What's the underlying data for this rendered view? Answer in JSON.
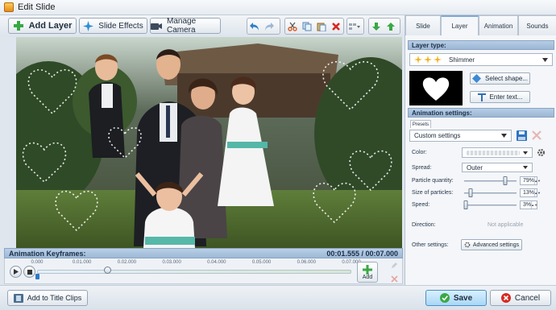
{
  "window": {
    "title": "Edit Slide"
  },
  "toolbar": {
    "add_layer": "Add Layer",
    "slide_effects": "Slide Effects",
    "manage_camera": "Manage Camera"
  },
  "keyframes": {
    "title": "Animation Keyframes:",
    "time": "00:01.555 / 00:07.000",
    "ticks": [
      "0.000",
      "0.01.000",
      "0.02.000",
      "0.03.000",
      "0.04.000",
      "0.05.000",
      "0.06.000",
      "0.07.000"
    ],
    "position": 0.222,
    "add_label": "Add"
  },
  "bottom": {
    "add_to_title_clips": "Add to Title Clips",
    "save": "Save",
    "cancel": "Cancel"
  },
  "panel": {
    "tabs": [
      "Slide",
      "Layer",
      "Animation",
      "Sounds"
    ],
    "active_tab": "Layer",
    "layer_type_header": "Layer type:",
    "layer_type_value": "Shimmer",
    "select_shape": "Select shape...",
    "enter_text": "Enter text...",
    "anim_header": "Animation settings:",
    "presets_label": "Presets",
    "preset_value": "Custom settings",
    "color_label": "Color:",
    "spread_label": "Spread:",
    "spread_value": "Outer",
    "particle_quantity": {
      "label": "Particle quantity:",
      "value": "79%",
      "level": 79
    },
    "particle_size": {
      "label": "Size of particles:",
      "value": "13%",
      "level": 13
    },
    "speed": {
      "label": "Speed:",
      "value": "3%",
      "level": 3
    },
    "direction_label": "Direction:",
    "direction_value": "Not applicable",
    "other_label": "Other settings:",
    "advanced": "Advanced settings"
  },
  "colors": {
    "accent": "#2f7fc8",
    "section_header": "#a9c2df",
    "add_green": "#3aa845"
  }
}
